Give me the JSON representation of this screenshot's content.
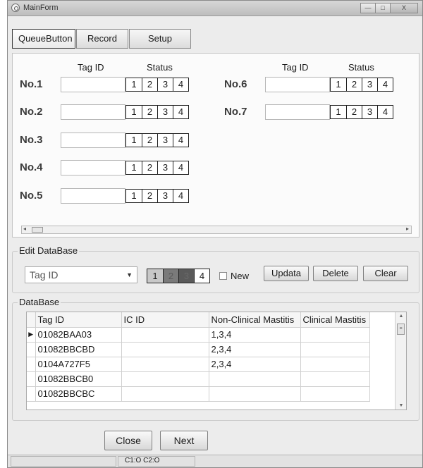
{
  "window": {
    "title": "MainForm",
    "controls": [
      "—",
      "□",
      "X"
    ]
  },
  "toolbar": {
    "queue_label": "QueueButton",
    "record_label": "Record",
    "setup_label": "Setup"
  },
  "queue": {
    "tag_id_header": "Tag ID",
    "status_header": "Status",
    "status_values": [
      "1",
      "2",
      "3",
      "4"
    ],
    "rows": [
      {
        "label": "No.1",
        "tag": ""
      },
      {
        "label": "No.2",
        "tag": ""
      },
      {
        "label": "No.3",
        "tag": ""
      },
      {
        "label": "No.4",
        "tag": ""
      },
      {
        "label": "No.5",
        "tag": ""
      },
      {
        "label": "No.6",
        "tag": ""
      },
      {
        "label": "No.7",
        "tag": ""
      }
    ]
  },
  "edit": {
    "title": "Edit DataBase",
    "combo_value": "Tag ID",
    "status_values": [
      "1",
      "2",
      "3",
      "4"
    ],
    "new_label": "New",
    "update_label": "Updata",
    "delete_label": "Delete",
    "clear_label": "Clear"
  },
  "database": {
    "title": "DataBase",
    "columns": [
      "Tag ID",
      "IC ID",
      "Non-Clinical Mastitis",
      "Clinical Mastitis"
    ],
    "rows": [
      {
        "tag": "01082BAA03",
        "ic": "",
        "non_clinical": "1,3,4",
        "clinical": ""
      },
      {
        "tag": "01082BBCBD",
        "ic": "",
        "non_clinical": "2,3,4",
        "clinical": ""
      },
      {
        "tag": "0104A727F5",
        "ic": "",
        "non_clinical": "2,3,4",
        "clinical": ""
      },
      {
        "tag": "01082BBCB0",
        "ic": "",
        "non_clinical": "",
        "clinical": ""
      },
      {
        "tag": "01082BBCBC",
        "ic": "",
        "non_clinical": "",
        "clinical": ""
      }
    ]
  },
  "footer": {
    "close_label": "Close",
    "next_label": "Next"
  },
  "statusbar": {
    "text": "C1:O C2:O"
  }
}
